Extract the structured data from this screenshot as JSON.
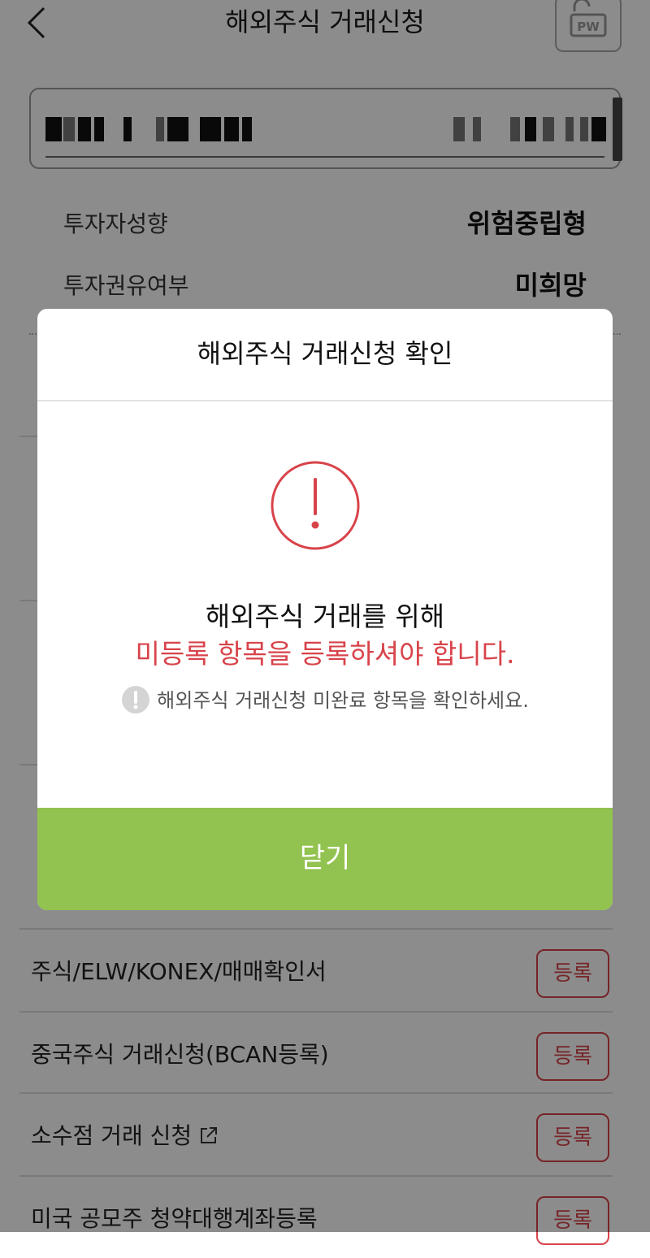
{
  "header": {
    "title": "해외주식 거래신청",
    "pw_label": "PW"
  },
  "info": [
    {
      "label": "투자자성향",
      "value": "위험중립형"
    },
    {
      "label": "투자권유여부",
      "value": "미희망"
    }
  ],
  "list": [
    {
      "label": "주식/ELW/KONEX/매매확인서",
      "button": "등록",
      "external": false
    },
    {
      "label": "중국주식 거래신청(BCAN등록)",
      "button": "등록",
      "external": false
    },
    {
      "label": "소수점 거래 신청",
      "button": "등록",
      "external": true
    },
    {
      "label": "미국 공모주 청약대행계좌등록",
      "button": "등록",
      "external": false
    }
  ],
  "modal": {
    "title": "해외주식 거래신청 확인",
    "line1": "해외주식 거래를 위해",
    "line2": "미등록 항목을 등록하셔야 합니다.",
    "note": "해외주식 거래신청 미완료 항목을 확인하세요.",
    "close_label": "닫기"
  },
  "colors": {
    "accent_red": "#d8434a",
    "close_green": "#92c24f"
  }
}
